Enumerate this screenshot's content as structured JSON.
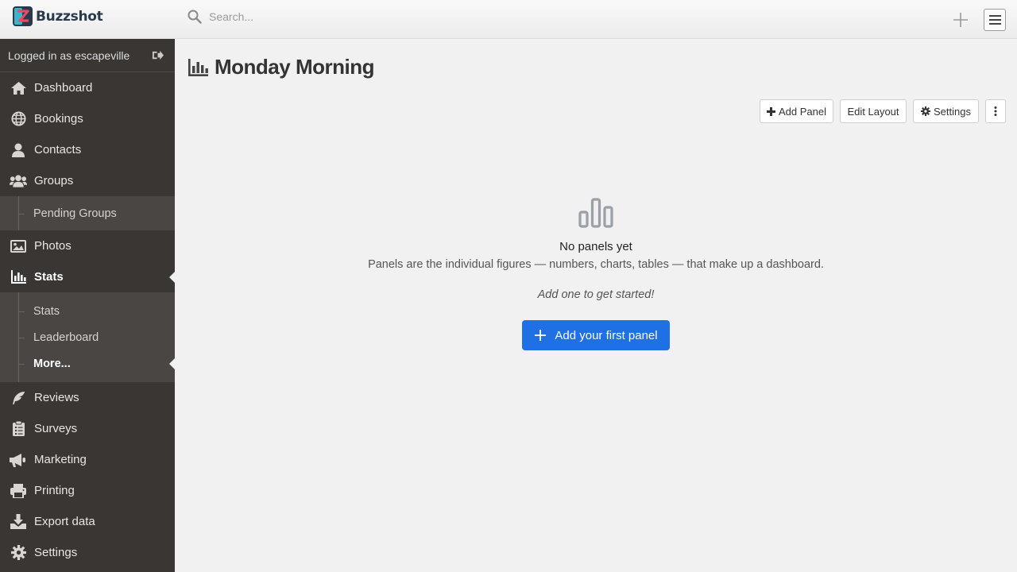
{
  "app": {
    "name": "Buzzshot"
  },
  "search": {
    "placeholder": "Search..."
  },
  "user": {
    "logged_in_text": "Logged in as escapeville"
  },
  "sidebar": {
    "items": [
      {
        "label": "Dashboard",
        "icon": "home-icon"
      },
      {
        "label": "Bookings",
        "icon": "globe-icon"
      },
      {
        "label": "Contacts",
        "icon": "user-icon"
      },
      {
        "label": "Groups",
        "icon": "users-icon"
      },
      {
        "label": "Photos",
        "icon": "image-icon"
      },
      {
        "label": "Stats",
        "icon": "bar-chart-icon",
        "active": true
      },
      {
        "label": "Reviews",
        "icon": "feather-icon"
      },
      {
        "label": "Surveys",
        "icon": "clipboard-icon"
      },
      {
        "label": "Marketing",
        "icon": "megaphone-icon"
      },
      {
        "label": "Printing",
        "icon": "printer-icon"
      },
      {
        "label": "Export data",
        "icon": "download-icon"
      },
      {
        "label": "Settings",
        "icon": "gear-icon"
      }
    ],
    "groups_sub": [
      {
        "label": "Pending Groups"
      }
    ],
    "stats_sub": [
      {
        "label": "Stats"
      },
      {
        "label": "Leaderboard"
      },
      {
        "label": "More...",
        "active": true
      }
    ]
  },
  "page": {
    "title": "Monday Morning"
  },
  "toolbar": {
    "add_panel": "Add Panel",
    "edit_layout": "Edit Layout",
    "settings": "Settings"
  },
  "empty_state": {
    "title": "No panels yet",
    "description": "Panels are the individual figures — numbers, charts, tables — that make up a dashboard.",
    "hint": "Add one to get started!",
    "cta": "Add your first panel"
  },
  "colors": {
    "accent": "#1f6fe5",
    "sidebar_bg": "#3a3633",
    "sidebar_sub_bg": "#4a4643"
  }
}
